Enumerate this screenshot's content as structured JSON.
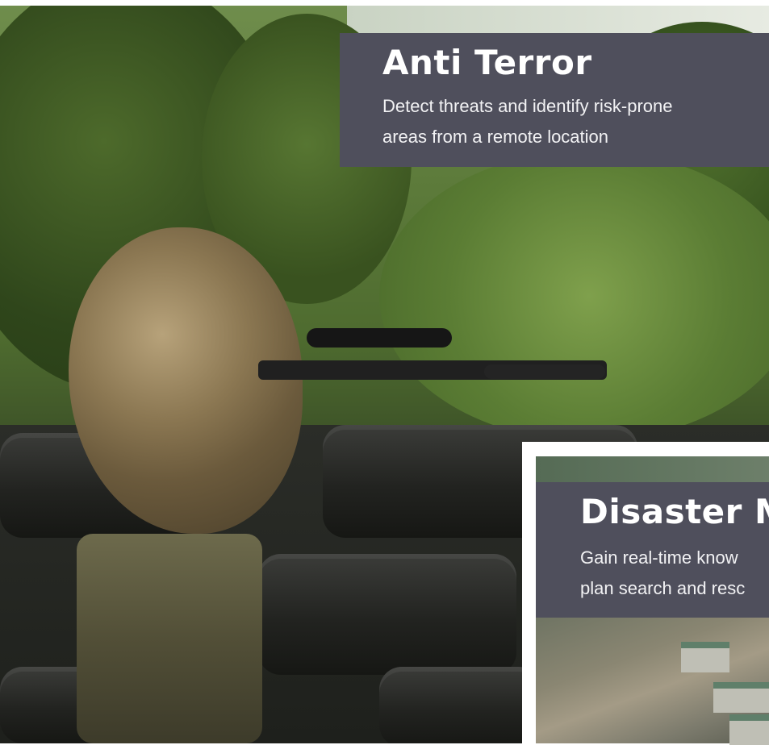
{
  "cards": [
    {
      "title": "Anti Terror",
      "description_lines": [
        "Detect threats and identify risk-prone",
        "areas from a remote location"
      ]
    },
    {
      "title": "Disaster M",
      "description_lines": [
        "Gain real-time know",
        "plan search and resc"
      ]
    }
  ],
  "colors": {
    "overlay": "#4f4f5c",
    "text": "#ffffff",
    "card_border": "#ffffff"
  },
  "images": {
    "hero": "sniper-in-ghillie-suit-photo",
    "disaster": "landslide-village-photo"
  }
}
